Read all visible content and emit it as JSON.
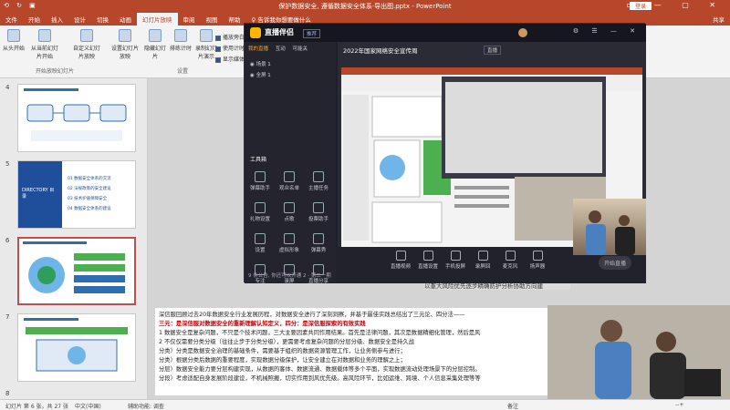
{
  "window": {
    "title": "保护数据安全, 遵循数据安全体系·导出图.pptx - PowerPoint",
    "quick_access": "⟲ ↻ ▣",
    "login_label": "登录",
    "share_label": "共享"
  },
  "tabs": [
    "文件",
    "开始",
    "插入",
    "设计",
    "切换",
    "动画",
    "幻灯片放映",
    "审阅",
    "视图",
    "帮助",
    "♀ 告诉我你想要做什么"
  ],
  "active_tab_index": 6,
  "ribbon": {
    "buttons": [
      "从头开始",
      "从当前幻灯片开始",
      "自定义幻灯片放映",
      "设置幻灯片放映",
      "隐藏幻灯片",
      "排练计时",
      "录制幻灯片演示"
    ],
    "group_start": "开始放映幻灯片",
    "group_setup": "设置",
    "checks": [
      "播放旁白",
      "使用计时",
      "显示媒体控件"
    ]
  },
  "slides": [
    {
      "num": "4"
    },
    {
      "num": "5",
      "label": "DIRECTORY 目录",
      "items": [
        "01 数据安全体系的交流",
        "02 法规政策的安全建设",
        "03 技术护盾保障安全",
        "04 数据安全体系的建设"
      ]
    },
    {
      "num": "6"
    },
    {
      "num": "7"
    },
    {
      "num": "8"
    }
  ],
  "notes": [
    {
      "text": "深信服回顾过去20年数据安全行业发展历程，对数据安全进行了深刻洞察，并基于最佳实践总结出了三元论、四分法——",
      "red": false
    },
    {
      "text": "三元：是深信服对数据安全的重新理解认知定义，四分：是深信服探索的有效实践",
      "red": true
    },
    {
      "text": "1 数据安全是复杂问题，不只是个技术问题，三大主要因素共同作用结果。首先是法律问题，其次是数据精细化管理，然后是风",
      "red": false
    },
    {
      "text": "2 不仅仅需要分类分级（往往止步于分类分级），更需要考虑复杂问题的分层分级、数据安全是持久战",
      "red": false
    },
    {
      "text": "分类）分类是数据安全治理的基础条件，需要基于组织的数据资源管理工作，让业务侧参与进行；",
      "red": false
    },
    {
      "text": "分类）根据分类后数据的重要程度，实现数据分级保护，让安全建立在对数据和业务的理解之上；",
      "red": false
    },
    {
      "text": "分层）数据安全能力要分层构建实现，从数据的客体、数据流通、数据载体等多个平面，实现数据流动处理场景下的分层控制。",
      "red": false
    },
    {
      "text": "分段）考虑适配自身发展阶段建设，不机械照搬，切实作用到风优先级。高风险环节，比如运维、跨境、个人信息采集处理等等",
      "red": false
    }
  ],
  "status": {
    "slide_info": "幻灯片 第 6 张，共 27 张",
    "lang": "中文(中国)",
    "accessibility": "辅助功能: 调查",
    "notes_label": "备注",
    "zoom": "--+"
  },
  "stream": {
    "app_name": "直播伴侣",
    "badge": "推荐",
    "room_title": "2022年国家网络安全宣传周",
    "tag": "直播",
    "tabs": [
      "我的直播",
      "互动",
      "可能关"
    ],
    "scene_items": [
      "场景 1",
      "全屏 1"
    ],
    "section": "工具箱",
    "tools": [
      "弹幕助手",
      "观众名单",
      "主播任务",
      "礼物设置",
      "点歌",
      "投票助手",
      "设置",
      "虚拟形象",
      "弹幕秀",
      "专注",
      "录屏",
      "直播分享"
    ],
    "bottom_tools": [
      "直播视频",
      "直播设置",
      "手机投屏",
      "录屏回",
      "麦克风",
      "扬声器"
    ],
    "go_live": "开始直播",
    "footer": "9 条公告, 你还可以开通 2 · 第二一期"
  },
  "colors": {
    "accent": "#b7472a",
    "stream_bg": "#1f1f29"
  }
}
